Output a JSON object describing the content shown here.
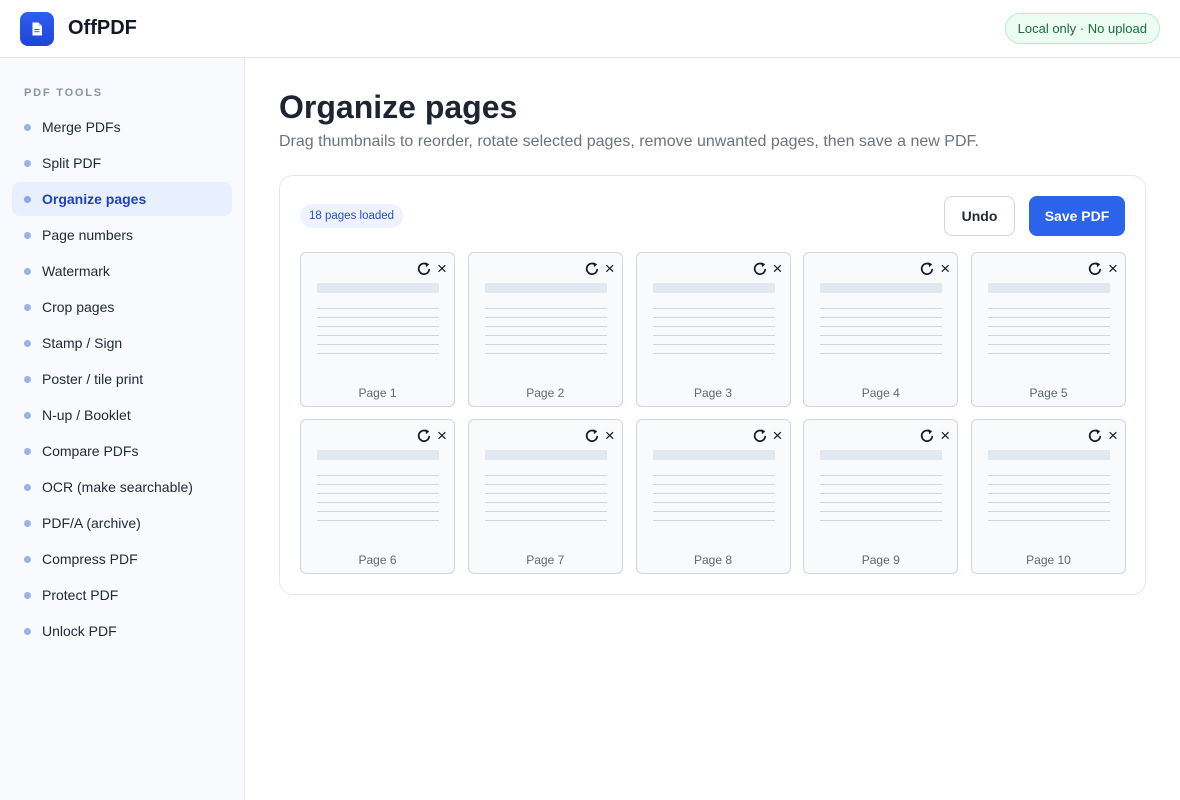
{
  "header": {
    "app_title": "OffPDF",
    "privacy_badge": "Local only · No upload",
    "brand_color": "#2b5be9"
  },
  "sidebar": {
    "heading": "PDF TOOLS",
    "items": [
      {
        "label": "Merge PDFs",
        "active": false
      },
      {
        "label": "Split PDF",
        "active": false
      },
      {
        "label": "Organize pages",
        "active": true
      },
      {
        "label": "Page numbers",
        "active": false
      },
      {
        "label": "Watermark",
        "active": false
      },
      {
        "label": "Crop pages",
        "active": false
      },
      {
        "label": "Stamp / Sign",
        "active": false
      },
      {
        "label": "Poster / tile print",
        "active": false
      },
      {
        "label": "N-up / Booklet",
        "active": false
      },
      {
        "label": "Compare PDFs",
        "active": false
      },
      {
        "label": "OCR (make searchable)",
        "active": false
      },
      {
        "label": "PDF/A (archive)",
        "active": false
      },
      {
        "label": "Compress PDF",
        "active": false
      },
      {
        "label": "Protect PDF",
        "active": false
      },
      {
        "label": "Unlock PDF",
        "active": false
      }
    ]
  },
  "main": {
    "title": "Organize pages",
    "subtitle": "Drag thumbnails to reorder, rotate selected pages, remove unwanted pages, then save a new PDF.",
    "panel": {
      "count_badge": "18 pages loaded",
      "undo_label": "Undo",
      "save_label": "Save PDF",
      "remove_glyph": "×",
      "pages": [
        {
          "label": "Page 1"
        },
        {
          "label": "Page 2"
        },
        {
          "label": "Page 3"
        },
        {
          "label": "Page 4"
        },
        {
          "label": "Page 5"
        },
        {
          "label": "Page 6"
        },
        {
          "label": "Page 7"
        },
        {
          "label": "Page 8"
        },
        {
          "label": "Page 9"
        },
        {
          "label": "Page 10"
        }
      ]
    }
  },
  "colors": {
    "accent": "#2b63eb",
    "active_nav_bg": "#e8efff",
    "active_nav_text": "#1e44b5",
    "success_bg": "#ecfdf3",
    "success_text": "#1e6b3c"
  }
}
